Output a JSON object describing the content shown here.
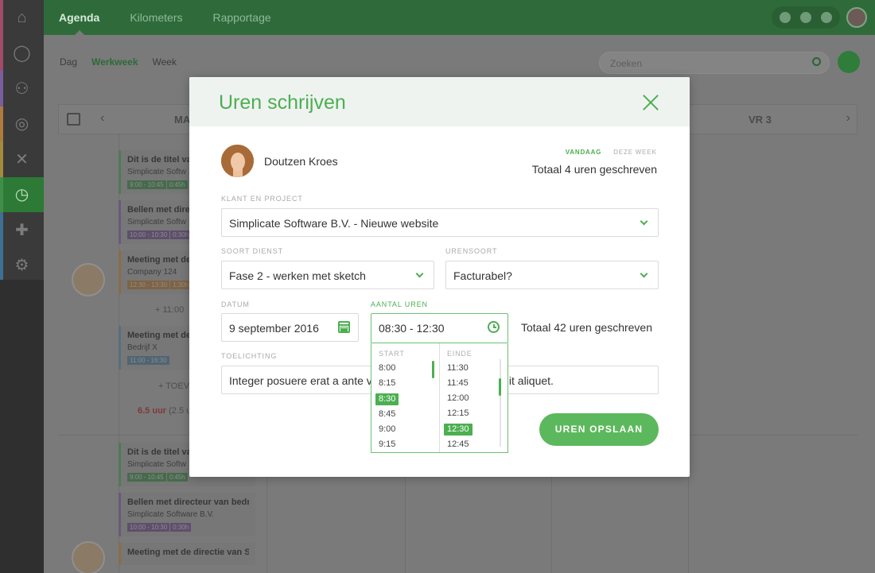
{
  "sidebar": {
    "icons": [
      "home-icon",
      "user-icon",
      "users-icon",
      "target-icon",
      "tools-icon",
      "clock-icon",
      "puzzle-icon",
      "gear-icon"
    ],
    "stripes": [
      "#a24a6a",
      "#a24a6a",
      "#7a5ea0",
      "#b07a3e",
      "#a48a3a",
      "#3f8f4a",
      "#3e6f95",
      "#3e6f95"
    ]
  },
  "topbar": {
    "tabs": [
      "Agenda",
      "Kilometers",
      "Rapportage"
    ]
  },
  "subbar": {
    "views": [
      "Dag",
      "Werkweek",
      "Week"
    ],
    "search_placeholder": "Zoeken"
  },
  "calendar": {
    "days": [
      "MA",
      "VR 3"
    ],
    "cards": [
      {
        "title": "Dit is de titel van",
        "sub": "Simplicate Softw",
        "tags": [
          "9:00 - 10:45",
          "0:45h"
        ]
      },
      {
        "title": "Bellen met direc",
        "sub": "Simplicate Softw",
        "tags": [
          "10:00 - 10:30",
          "0:30h"
        ]
      },
      {
        "title": "Meeting met de",
        "sub": "Company 124",
        "tags": [
          "12:30 - 13:30",
          "1:30h"
        ]
      },
      {
        "title": "Meeting met de",
        "sub": "Bedrijf X",
        "tags": [
          "11:00 - 16:30"
        ]
      },
      {
        "title": "Dit is de titel va",
        "sub": "Simplicate Softw",
        "tags": [
          "9:00 - 10:45",
          "0:45h"
        ]
      },
      {
        "title": "Bellen met directeur van bedri",
        "sub": "Simplicate Software B.V.",
        "tags": [
          "10:00 - 10:30",
          "0:30h"
        ]
      },
      {
        "title": "Meeting met de directie van Si",
        "sub": "",
        "tags": []
      }
    ],
    "add_label": "+ 11:00",
    "add_label_2": "+ TOEV",
    "summary_red": "6.5 uur",
    "summary_rest": "(2.5 uu"
  },
  "modal": {
    "title": "Uren schrijven",
    "user_name": "Doutzen Kroes",
    "totals_tabs": [
      "VANDAAG",
      "DEZE WEEK"
    ],
    "totals_text": "Totaal 4 uren geschreven",
    "client_project": {
      "label": "KLANT EN PROJECT",
      "value": "Simplicate Software B.V. - Nieuwe website"
    },
    "service": {
      "label": "SOORT DIENST",
      "value": "Fase 2 - werken met sketch"
    },
    "hours_type": {
      "label": "URENSOORT",
      "value": "Facturabel?"
    },
    "date": {
      "label": "DATUM",
      "value": "9 september 2016"
    },
    "hours": {
      "label": "AANTAL UREN",
      "value": "08:30 - 12:30"
    },
    "hours_total": "Totaal 42 uren geschreven",
    "note": {
      "label": "TOELICHTING",
      "value_start": "Integer posuere erat a ante ve",
      "value_end": "elit aliquet."
    },
    "time_picker": {
      "start_label": "START",
      "end_label": "EINDE",
      "start_options": [
        "8:00",
        "8:15",
        "8:30",
        "8:45",
        "9:00",
        "9:15"
      ],
      "start_selected": "8:30",
      "end_options": [
        "11:30",
        "11:45",
        "12:00",
        "12:15",
        "12:30",
        "12:45"
      ],
      "end_selected": "12:30"
    },
    "save_button": "UREN OPSLAAN"
  },
  "colors": {
    "accent": "#4caf50",
    "header_bg": "#eff3f0",
    "topbar": "#2f6b3a"
  }
}
